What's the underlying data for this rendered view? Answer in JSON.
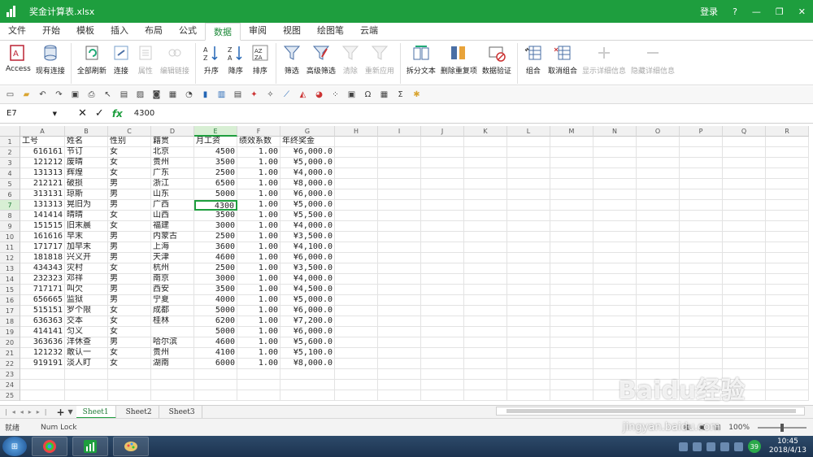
{
  "window": {
    "title": "奖金计算表.xlsx",
    "login": "登录",
    "help": "?",
    "minimize": "—",
    "restore": "❐",
    "close": "✕"
  },
  "tabs": [
    "文件",
    "开始",
    "模板",
    "插入",
    "布局",
    "公式",
    "数据",
    "审阅",
    "视图",
    "绘图笔",
    "云端"
  ],
  "active_tab": "数据",
  "ribbon": {
    "access": "Access",
    "existing": "现有连接",
    "refresh_all": "全部刷新",
    "connect": "连接",
    "properties": "属性",
    "edit_links": "编辑链接",
    "sort_asc": "升序",
    "sort_desc": "降序",
    "sort": "排序",
    "filter": "筛选",
    "adv_filter": "高级筛选",
    "clear": "清除",
    "reapply": "重新应用",
    "text_to_cols": "拆分文本",
    "remove_dup": "删除重复项",
    "validation": "数据验证",
    "group": "组合",
    "ungroup": "取消组合",
    "show_detail": "显示详细信息",
    "hide_detail": "隐藏详细信息"
  },
  "formula_bar": {
    "name_box": "E7",
    "fx": "fx",
    "value": "4300"
  },
  "columns": [
    "A",
    "B",
    "C",
    "D",
    "E",
    "F",
    "G",
    "H",
    "I",
    "J",
    "K",
    "L",
    "M",
    "N",
    "O",
    "P",
    "Q",
    "R"
  ],
  "rows": [
    "1",
    "2",
    "3",
    "4",
    "5",
    "6",
    "7",
    "8",
    "9",
    "10",
    "11",
    "12",
    "13",
    "14",
    "15",
    "16",
    "17",
    "18",
    "19",
    "20",
    "21",
    "22",
    "23",
    "24",
    "25"
  ],
  "headers": [
    "工号",
    "姓名",
    "性别",
    "籍贯",
    "月工资",
    "绩效系数",
    "年终奖金"
  ],
  "table": [
    [
      "616161",
      "节订",
      "女",
      "北京",
      "4500",
      "1.00",
      "¥6,000.0"
    ],
    [
      "121212",
      "废晴",
      "女",
      "贵州",
      "3500",
      "1.00",
      "¥5,000.0"
    ],
    [
      "131313",
      "辉煌",
      "女",
      "广东",
      "2500",
      "1.00",
      "¥4,000.0"
    ],
    [
      "212121",
      "破损",
      "男",
      "浙江",
      "6500",
      "1.00",
      "¥8,000.0"
    ],
    [
      "313131",
      "琼斯",
      "男",
      "山东",
      "5000",
      "1.00",
      "¥6,000.0"
    ],
    [
      "131313",
      "晃旧为",
      "男",
      "广西",
      "4300",
      "1.00",
      "¥5,000.0"
    ],
    [
      "141414",
      "晴晴",
      "女",
      "山西",
      "3500",
      "1.00",
      "¥5,500.0"
    ],
    [
      "151515",
      "旧末晨",
      "女",
      "福建",
      "3000",
      "1.00",
      "¥4,000.0"
    ],
    [
      "161616",
      "早末",
      "男",
      "内蒙古",
      "2500",
      "1.00",
      "¥3,500.0"
    ],
    [
      "171717",
      "加早末",
      "男",
      "上海",
      "3600",
      "1.00",
      "¥4,100.0"
    ],
    [
      "181818",
      "兴义开",
      "男",
      "天津",
      "4600",
      "1.00",
      "¥6,000.0"
    ],
    [
      "434343",
      "灾村",
      "女",
      "杭州",
      "2500",
      "1.00",
      "¥3,500.0"
    ],
    [
      "232323",
      "邓祥",
      "男",
      "南京",
      "3000",
      "1.00",
      "¥4,000.0"
    ],
    [
      "717171",
      "叫欠",
      "男",
      "西安",
      "3500",
      "1.00",
      "¥4,500.0"
    ],
    [
      "656665",
      "监狱",
      "男",
      "宁夏",
      "4000",
      "1.00",
      "¥5,000.0"
    ],
    [
      "515151",
      "罗个限",
      "女",
      "成都",
      "5000",
      "1.00",
      "¥6,000.0"
    ],
    [
      "636363",
      "交本",
      "女",
      "桂林",
      "6200",
      "1.00",
      "¥7,200.0"
    ],
    [
      "414141",
      "匀义",
      "女",
      "",
      "5000",
      "1.00",
      "¥6,000.0"
    ],
    [
      "363636",
      "洋休查",
      "男",
      "哈尔滨",
      "4600",
      "1.00",
      "¥5,600.0"
    ],
    [
      "121232",
      "敢认一",
      "女",
      "贵州",
      "4100",
      "1.00",
      "¥5,100.0"
    ],
    [
      "919191",
      "淡人盯",
      "女",
      "湖南",
      "6000",
      "1.00",
      "¥8,000.0"
    ]
  ],
  "sheets": [
    "Sheet1",
    "Sheet2",
    "Sheet3"
  ],
  "active_sheet": "Sheet1",
  "status": {
    "ready": "就绪",
    "numlock": "Num Lock",
    "zoom": "100%"
  },
  "taskbar": {
    "time": "10:45",
    "date": "2018/4/13",
    "badge": "39"
  },
  "watermark": {
    "text": "Baidu经验",
    "url": "jingyan.baidu.com"
  }
}
